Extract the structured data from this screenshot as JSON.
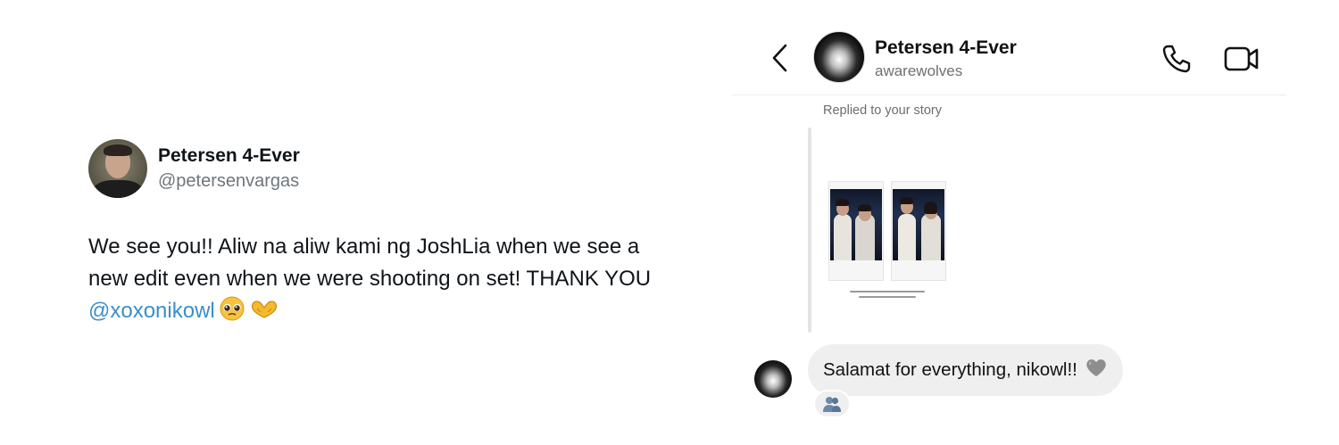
{
  "tweet": {
    "display_name": "Petersen 4-Ever",
    "handle": "@petersenvargas",
    "text_line1": "We see you!! Aliw na aliw kami ng JoshLia when we see a",
    "text_line2": "new edit even when we were shooting on set! THANK YOU",
    "mention": "@xoxonikowl",
    "emojis": [
      "pleading-face-icon",
      "heart-hands-icon"
    ],
    "mention_color": "#3b8fc7"
  },
  "chat": {
    "header": {
      "title": "Petersen 4-Ever",
      "username": "awarewolves",
      "icons": [
        "back-chevron-icon",
        "phone-icon",
        "video-camera-icon"
      ]
    },
    "replied_label": "Replied to your story",
    "message": {
      "text": "Salamat for everything, nikowl!!",
      "emoji": "grey-heart-icon"
    },
    "reaction": "people-icon",
    "bubble_color": "#efefef"
  }
}
